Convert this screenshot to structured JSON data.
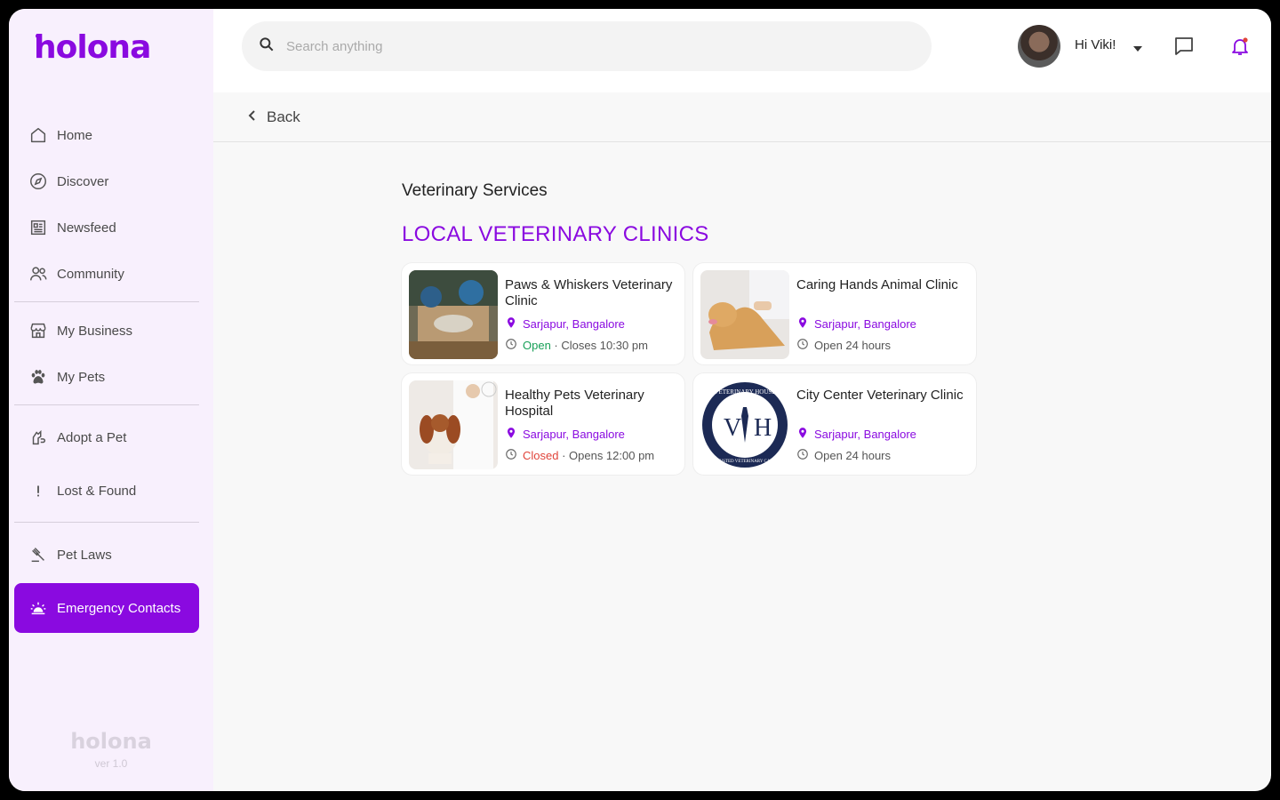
{
  "brand": {
    "logo_text": "holona",
    "footer_logo_text": "holona",
    "version": "ver 1.0",
    "accent": "#8a0ae0"
  },
  "search": {
    "placeholder": "Search anything"
  },
  "user": {
    "greeting": "Hi Viki!"
  },
  "sidebar": {
    "items": [
      {
        "label": "Home",
        "icon": "home-icon"
      },
      {
        "label": "Discover",
        "icon": "compass-icon"
      },
      {
        "label": "Newsfeed",
        "icon": "newspaper-icon"
      },
      {
        "label": "Community",
        "icon": "people-icon"
      },
      {
        "label": "My Business",
        "icon": "store-icon"
      },
      {
        "label": "My Pets",
        "icon": "paw-icon"
      },
      {
        "label": "Adopt a Pet",
        "icon": "adopt-icon"
      },
      {
        "label": "Lost & Found",
        "icon": "exclamation-icon"
      },
      {
        "label": "Pet Laws",
        "icon": "gavel-icon"
      },
      {
        "label": "Emergency Contacts",
        "icon": "siren-icon",
        "active": true
      }
    ]
  },
  "nav": {
    "back_label": "Back"
  },
  "content": {
    "section_title": "Veterinary Services",
    "heading": "LOCAL VETERINARY CLINICS",
    "clinics": [
      {
        "name": "Paws & Whiskers Veterinary Clinic",
        "location": "Sarjapur, Bangalore",
        "status": "Open",
        "status_type": "open",
        "hours": " · Closes 10:30 pm"
      },
      {
        "name": "Caring Hands Animal Clinic",
        "location": "Sarjapur, Bangalore",
        "status": "",
        "status_type": "none",
        "hours": "Open 24 hours"
      },
      {
        "name": "Healthy Pets Veterinary Hospital",
        "location": "Sarjapur, Bangalore",
        "status": "Closed",
        "status_type": "closed",
        "hours": " · Opens 12:00 pm"
      },
      {
        "name": "City Center Veterinary Clinic",
        "location": "Sarjapur, Bangalore",
        "status": "",
        "status_type": "none",
        "hours": "Open 24 hours"
      }
    ],
    "logo_lettering": {
      "top": "VETERINARY HOUSE",
      "bottom": "TRUSTED VETERINARY CARE",
      "initials_left": "V",
      "initials_right": "H"
    }
  }
}
